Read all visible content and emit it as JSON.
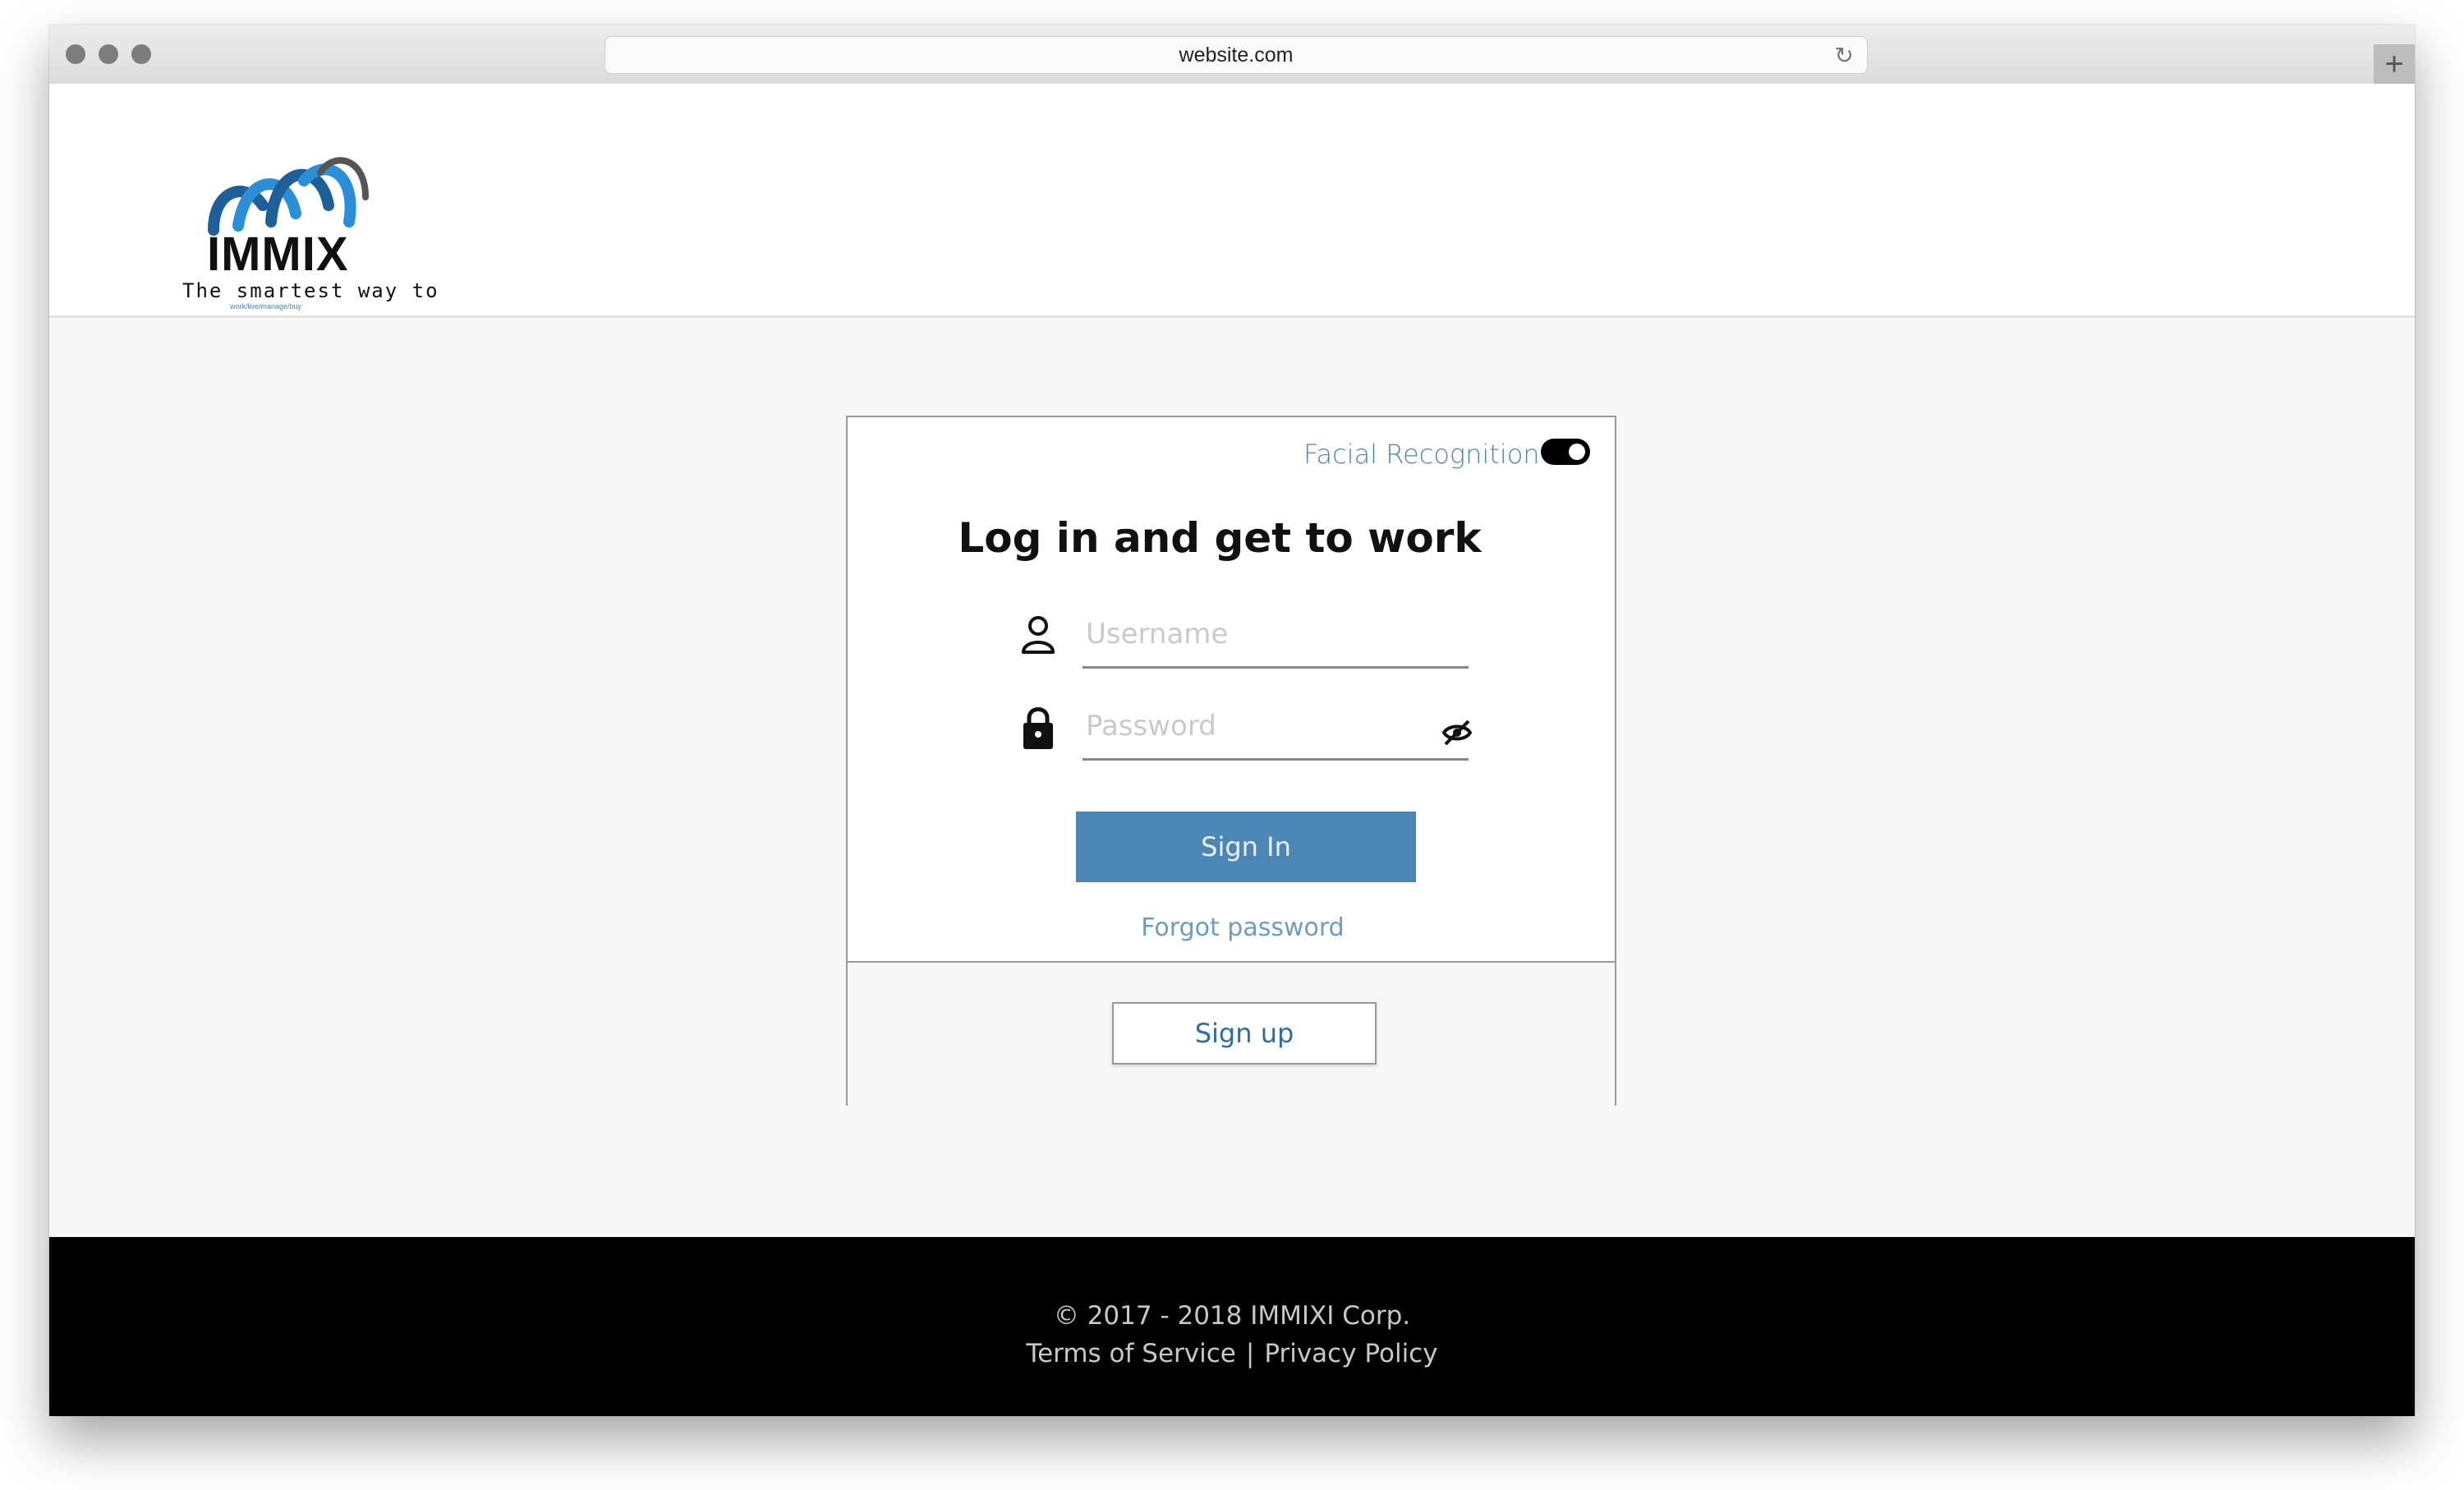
{
  "browser": {
    "url": "website.com",
    "reload_icon": "reload-icon",
    "new_tab_label": "+"
  },
  "header": {
    "logo": {
      "word": "IMMIX",
      "tagline": "The smartest way to",
      "sub_tagline": "work/live/manage/buy",
      "colors": [
        "#1f5f99",
        "#2a8fd6",
        "#111111"
      ]
    }
  },
  "login": {
    "facial_recognition_label": "Facial Recognition",
    "facial_recognition_enabled": true,
    "title": "Log in and get to work",
    "username_placeholder": "Username",
    "username_value": "",
    "password_placeholder": "Password",
    "password_value": "",
    "sign_in_label": "Sign In",
    "forgot_password_label": "Forgot password",
    "sign_up_label": "Sign up",
    "icons": {
      "username": "user-icon",
      "password": "lock-icon",
      "visibility": "eye-off-icon"
    }
  },
  "footer": {
    "copyright": "© 2017 - 2018 IMMIXI Corp.",
    "terms_label": "Terms of Service",
    "separator": "|",
    "privacy_label": "Privacy Policy"
  },
  "colors": {
    "primary_button": "#4b86b4",
    "link": "#4d86b0",
    "footer_bg": "#000000",
    "page_bg": "#f7f7f7"
  }
}
